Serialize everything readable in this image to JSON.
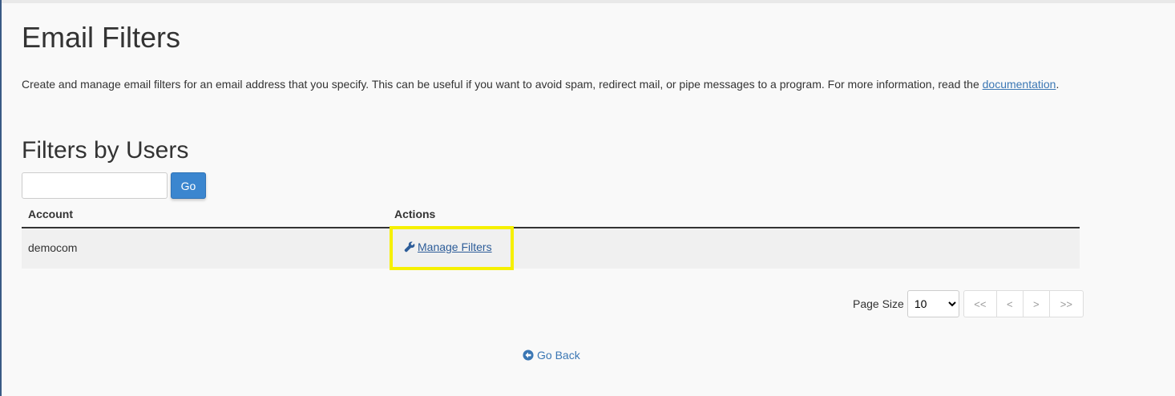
{
  "page": {
    "title": "Email Filters",
    "intro_text": "Create and manage email filters for an email address that you specify. This can be useful if you want to avoid spam, redirect mail, or pipe messages to a program. For more information, read the ",
    "intro_link": "documentation",
    "intro_end": "."
  },
  "filters": {
    "section_title": "Filters by Users",
    "search_value": "",
    "search_placeholder": "",
    "go_label": "Go"
  },
  "table": {
    "headers": {
      "account": "Account",
      "actions": "Actions"
    },
    "rows": [
      {
        "account": "democom",
        "action_label": " Manage Filters",
        "action_icon": "wrench-icon"
      }
    ]
  },
  "pagination": {
    "page_size_label": "Page Size",
    "page_size_value": "10",
    "page_size_options": [
      "10"
    ],
    "first": "<<",
    "prev": "<",
    "next": ">",
    "last": ">>"
  },
  "footer": {
    "go_back_label": "Go Back",
    "go_back_icon": "circle-arrow-left-icon"
  },
  "colors": {
    "primary_button": "#3b86cf",
    "link": "#2d5d99",
    "highlight": "#f6f000"
  }
}
